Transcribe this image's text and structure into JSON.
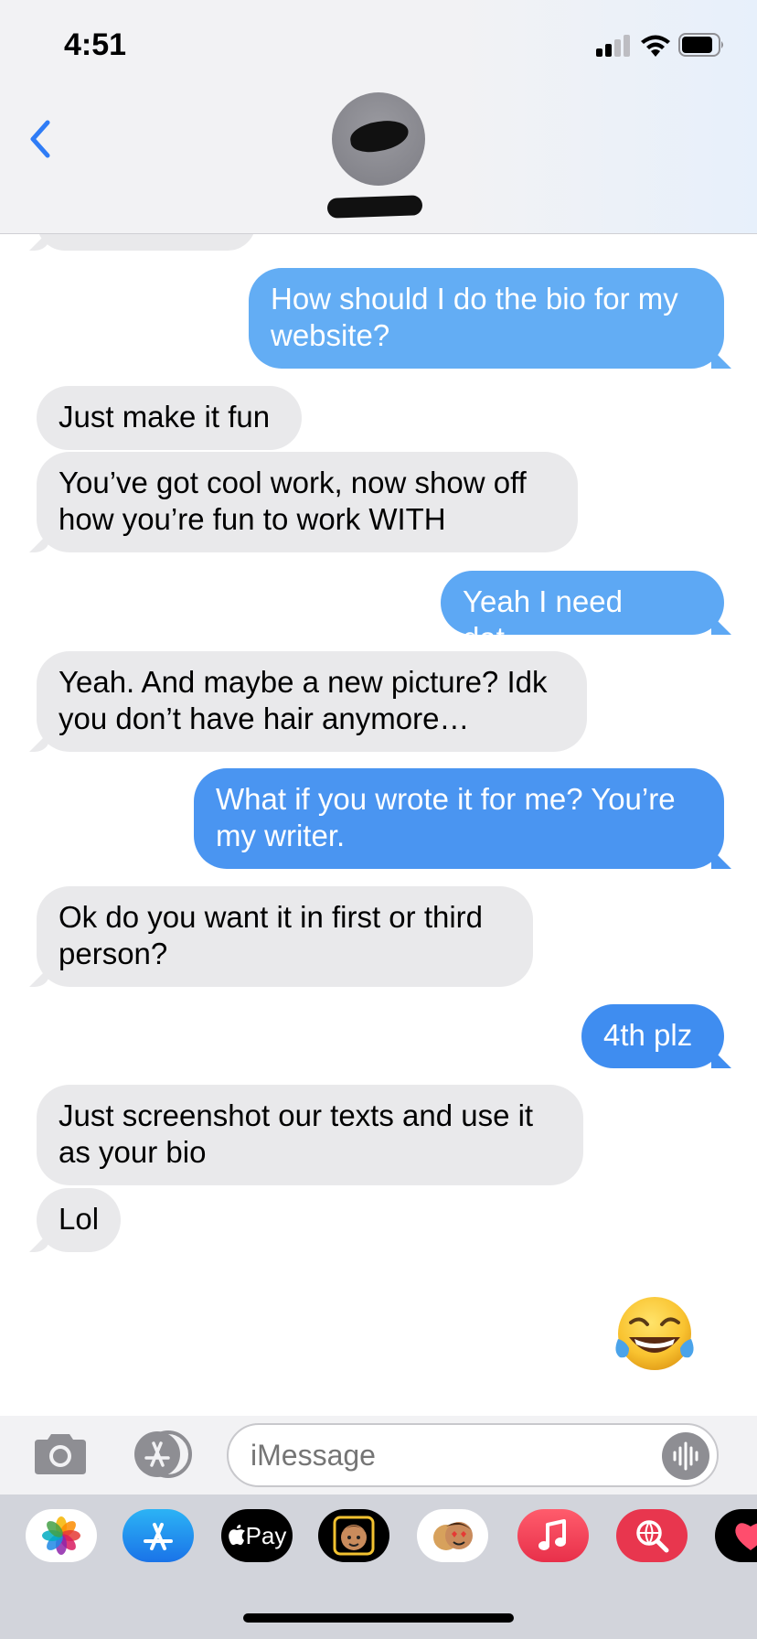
{
  "status_bar": {
    "time": "4:51"
  },
  "conversation": {
    "messages": [
      {
        "side": "outgoing",
        "text": "How should I do the bio for my website?"
      },
      {
        "side": "incoming",
        "text": "Just make it fun"
      },
      {
        "side": "incoming",
        "text": "You’ve got cool work, now show off how you’re fun to work WITH"
      },
      {
        "side": "outgoing",
        "text": "Yeah I need dat…"
      },
      {
        "side": "incoming",
        "text": "Yeah. And maybe a new picture? Idk you don’t have hair anymore…"
      },
      {
        "side": "outgoing",
        "text": "What if you wrote it for me? You’re my writer."
      },
      {
        "side": "incoming",
        "text": "Ok do you want it in first or third person?"
      },
      {
        "side": "outgoing",
        "text": "4th plz"
      },
      {
        "side": "incoming",
        "text": "Just screenshot our texts and use it as your bio"
      },
      {
        "side": "incoming",
        "text": "Lol"
      },
      {
        "side": "outgoing",
        "text": "😂",
        "type": "emoji"
      }
    ]
  },
  "compose": {
    "placeholder": "iMessage"
  },
  "app_drawer": {
    "apps": [
      {
        "name": "photos-app",
        "icon": "photos-icon"
      },
      {
        "name": "app-store-app",
        "icon": "app-store-icon"
      },
      {
        "name": "apple-pay-app",
        "label": "Pay",
        "icon": "apple-logo-icon"
      },
      {
        "name": "memoji-app",
        "icon": "memoji-icon"
      },
      {
        "name": "memoji-stickers-app",
        "icon": "memoji-stickers-icon"
      },
      {
        "name": "music-app",
        "icon": "music-note-icon"
      },
      {
        "name": "search-images-app",
        "icon": "globe-search-icon"
      },
      {
        "name": "digital-touch-app",
        "icon": "heart-icon"
      }
    ]
  },
  "colors": {
    "outgoing_top": "#64aef3",
    "outgoing_bottom": "#3f8df0",
    "incoming": "#e9e9eb",
    "accent": "#2f7cf6"
  }
}
